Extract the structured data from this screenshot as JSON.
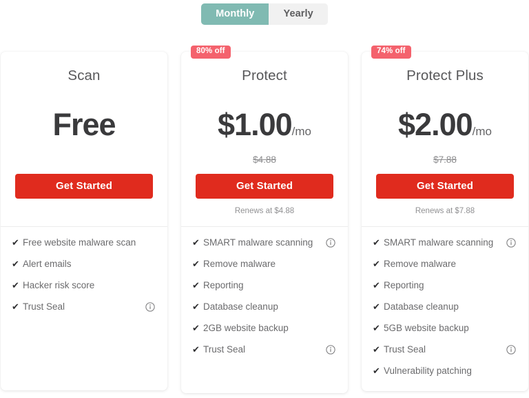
{
  "billing_toggle": {
    "options": [
      {
        "label": "Monthly",
        "active": true
      },
      {
        "label": "Yearly",
        "active": false
      }
    ]
  },
  "colors": {
    "accent_teal": "#80bab2",
    "cta_red": "#e02b1e",
    "badge_red": "#f4626d",
    "title_gray": "#58585a",
    "price_dark": "#3a3a3c"
  },
  "plans": [
    {
      "name": "Scan",
      "badge": "",
      "price": "Free",
      "price_unit": "",
      "old_price": "",
      "cta_label": "Get Started",
      "renews_text": "",
      "features": [
        {
          "label": "Free website malware scan",
          "info": false
        },
        {
          "label": "Alert emails",
          "info": false
        },
        {
          "label": "Hacker risk score",
          "info": false
        },
        {
          "label": "Trust Seal",
          "info": true
        }
      ]
    },
    {
      "name": "Protect",
      "badge": "80% off",
      "price": "$1.00",
      "price_unit": "/mo",
      "old_price": "$4.88",
      "cta_label": "Get Started",
      "renews_text": "Renews at $4.88",
      "features": [
        {
          "label": "SMART malware scanning",
          "info": true
        },
        {
          "label": "Remove malware",
          "info": false
        },
        {
          "label": "Reporting",
          "info": false
        },
        {
          "label": "Database cleanup",
          "info": false
        },
        {
          "label": "2GB website backup",
          "info": false
        },
        {
          "label": "Trust Seal",
          "info": true
        }
      ]
    },
    {
      "name": "Protect Plus",
      "badge": "74% off",
      "price": "$2.00",
      "price_unit": "/mo",
      "old_price": "$7.88",
      "cta_label": "Get Started",
      "renews_text": "Renews at $7.88",
      "features": [
        {
          "label": "SMART malware scanning",
          "info": true
        },
        {
          "label": "Remove malware",
          "info": false
        },
        {
          "label": "Reporting",
          "info": false
        },
        {
          "label": "Database cleanup",
          "info": false
        },
        {
          "label": "5GB website backup",
          "info": false
        },
        {
          "label": "Trust Seal",
          "info": true
        },
        {
          "label": "Vulnerability patching",
          "info": false
        }
      ]
    }
  ],
  "icons": {
    "check": "✔",
    "info": "info-icon"
  }
}
